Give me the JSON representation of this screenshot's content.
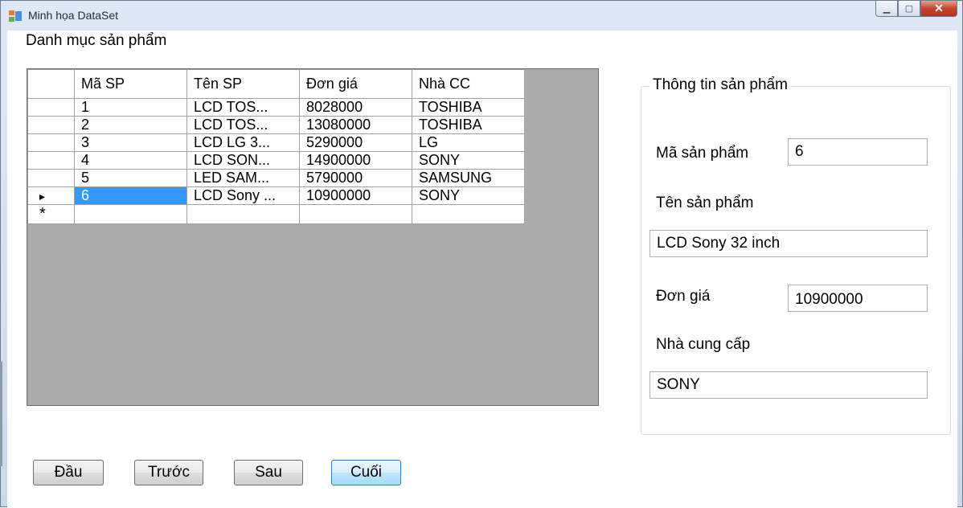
{
  "window": {
    "title": "Minh họa DataSet"
  },
  "heading": "Danh mục sản phẩm",
  "grid": {
    "columns": [
      "Mã SP",
      "Tên SP",
      "Đơn giá",
      "Nhà CC"
    ],
    "rows": [
      {
        "ma": "1",
        "ten": "LCD TOS...",
        "gia": "8028000",
        "ncc": "TOSHIBA"
      },
      {
        "ma": "2",
        "ten": "LCD TOS...",
        "gia": "13080000",
        "ncc": "TOSHIBA"
      },
      {
        "ma": "3",
        "ten": "LCD LG 3...",
        "gia": "5290000",
        "ncc": "LG"
      },
      {
        "ma": "4",
        "ten": "LCD SON...",
        "gia": "14900000",
        "ncc": "SONY"
      },
      {
        "ma": "5",
        "ten": "LED SAM...",
        "gia": "5790000",
        "ncc": "SAMSUNG"
      },
      {
        "ma": "6",
        "ten": "LCD Sony ...",
        "gia": "10900000",
        "ncc": "SONY"
      }
    ],
    "current_marker": "▸",
    "new_row_marker": "*"
  },
  "details": {
    "group_title": "Thông tin sản phẩm",
    "ma_label": "Mã sản phẩm",
    "ma_value": "6",
    "ten_label": "Tên sản phẩm",
    "ten_value": "LCD Sony 32 inch",
    "gia_label": "Đơn giá",
    "gia_value": "10900000",
    "ncc_label": "Nhà cung cấp",
    "ncc_value": "SONY"
  },
  "nav": {
    "first": "Đầu",
    "prev": "Trước",
    "next": "Sau",
    "last": "Cuối"
  }
}
